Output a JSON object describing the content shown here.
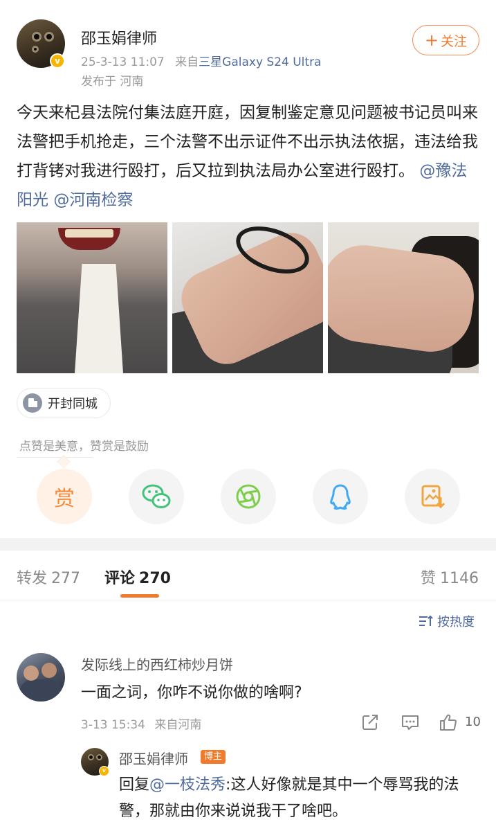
{
  "post": {
    "author": "邵玉娟律师",
    "verified_badge": "v",
    "time": "25-3-13 11:07",
    "source_prefix": "来自",
    "device": "三星Galaxy S24 Ultra",
    "location": "发布于 河南",
    "follow_label": "关注",
    "follow_plus": "+",
    "text_main": "今天来杞县法院付集法庭开庭，因复制鉴定意见问题被书记员叫来法警把手机抢走，三个法警不出示证件不出示执法依据，违法给我打背铐对我进行殴打，后又拉到执法局办公室进行殴打。",
    "mention_1": "@豫法阳光",
    "mention_2": "@河南检察",
    "location_chip": "开封同城",
    "tip": "点赞是美意，赞赏是鼓励"
  },
  "share": {
    "reward_label": "赏",
    "reward_icon": "reward-icon",
    "wechat_icon": "wechat-icon",
    "moments_icon": "moments-icon",
    "qq_icon": "qq-icon",
    "save_image_icon": "save-image-icon",
    "colors": {
      "reward": "#f28a3c",
      "wechat": "#3fc47a",
      "moments": "#7ccf4a",
      "qq": "#3fa9f5",
      "save": "#f0a640"
    }
  },
  "tabs": [
    {
      "label": "转发",
      "count": "277"
    },
    {
      "label": "评论",
      "count": "270"
    },
    {
      "label": "赞",
      "count": "1146"
    }
  ],
  "sort_label": "按热度",
  "comment": {
    "author": "发际线上的西红柿炒月饼",
    "text": "一面之词，你咋不说你做的啥啊?",
    "time": "3-13 15:34",
    "location": "来自河南",
    "likes": "10"
  },
  "reply": {
    "author": "邵玉娟律师",
    "badge": "博主",
    "prefix": "回复",
    "mention": "@一枝法秀",
    "text": ":这人好像就是其中一个辱骂我的法警，那就由你来说说我干了啥吧。"
  },
  "accent_color": "#f17b2c",
  "link_color": "#506b9e"
}
